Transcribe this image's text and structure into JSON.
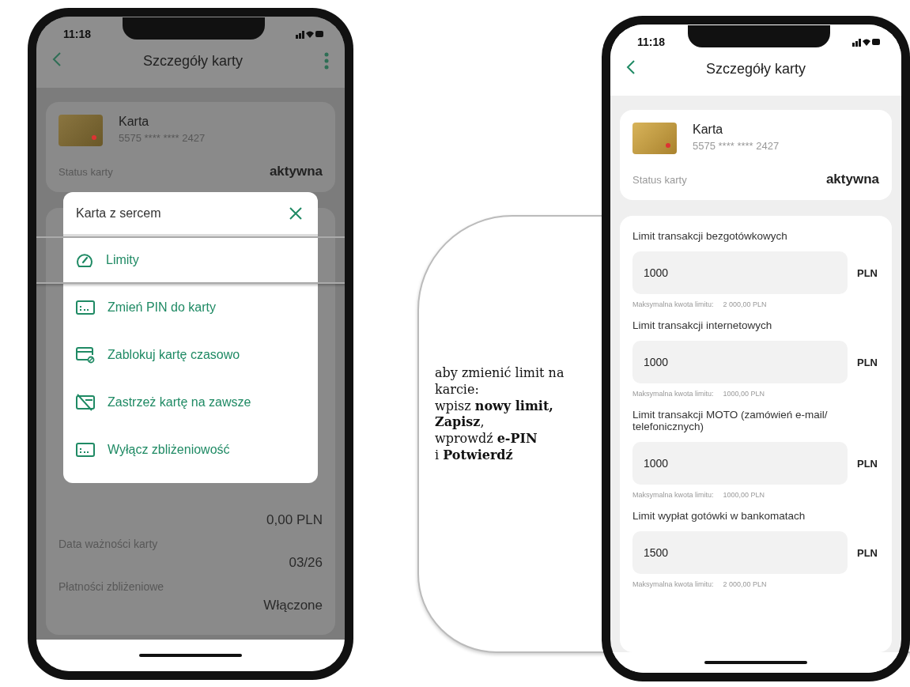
{
  "left_phone": {
    "time": "11:18",
    "header": {
      "title": "Szczegóły karty"
    },
    "card": {
      "name": "Karta",
      "number": "5575 **** **** 2427",
      "status_label": "Status karty",
      "status_value": "aktywna"
    },
    "details": [
      {
        "value": "0,00 PLN"
      },
      {
        "label": "Data ważności karty",
        "value": "03/26"
      },
      {
        "label": "Płatności zbliżeniowe",
        "value": "Włączone"
      }
    ],
    "menu": {
      "title": "Karta z sercem",
      "items": [
        {
          "label": "Limity",
          "kind": "gauge",
          "selected": true
        },
        {
          "label": "Zmień PIN do karty",
          "kind": "card",
          "selected": false
        },
        {
          "label": "Zablokuj kartę czasowo",
          "kind": "card-lock",
          "selected": false
        },
        {
          "label": "Zastrzeż kartę na zawsze",
          "kind": "card-cancel",
          "selected": false
        },
        {
          "label": "Wyłącz zbliżeniowość",
          "kind": "card",
          "selected": false
        }
      ]
    }
  },
  "right_phone": {
    "time": "11:18",
    "header": {
      "title": "Szczegóły karty"
    },
    "card": {
      "name": "Karta",
      "number": "5575 **** **** 2427",
      "status_label": "Status karty",
      "status_value": "aktywna"
    },
    "limits": [
      {
        "label": "Limit transakcji bezgotówkowych",
        "value": "1000",
        "currency": "PLN",
        "max_label": "Maksymalna kwota limitu:",
        "max_value": "2 000,00 PLN"
      },
      {
        "label": "Limit transakcji internetowych",
        "value": "1000",
        "currency": "PLN",
        "max_label": "Maksymalna kwota limitu:",
        "max_value": "1000,00 PLN"
      },
      {
        "label": "Limit transakcji MOTO (zamówień e-mail/ telefonicznych)",
        "value": "1000",
        "currency": "PLN",
        "max_label": "Maksymalna kwota limitu:",
        "max_value": "1000,00 PLN"
      },
      {
        "label": "Limit wypłat gotówki w bankomatach",
        "value": "1500",
        "currency": "PLN",
        "max_label": "Maksymalna kwota limitu:",
        "max_value": "2 000,00 PLN"
      }
    ]
  },
  "caption": [
    "aby zmienić limit na karcie:",
    "wpisz **nowy limit, Zapisz**,",
    "wprowdź **e-PIN**",
    "i **Potwierdź**"
  ]
}
